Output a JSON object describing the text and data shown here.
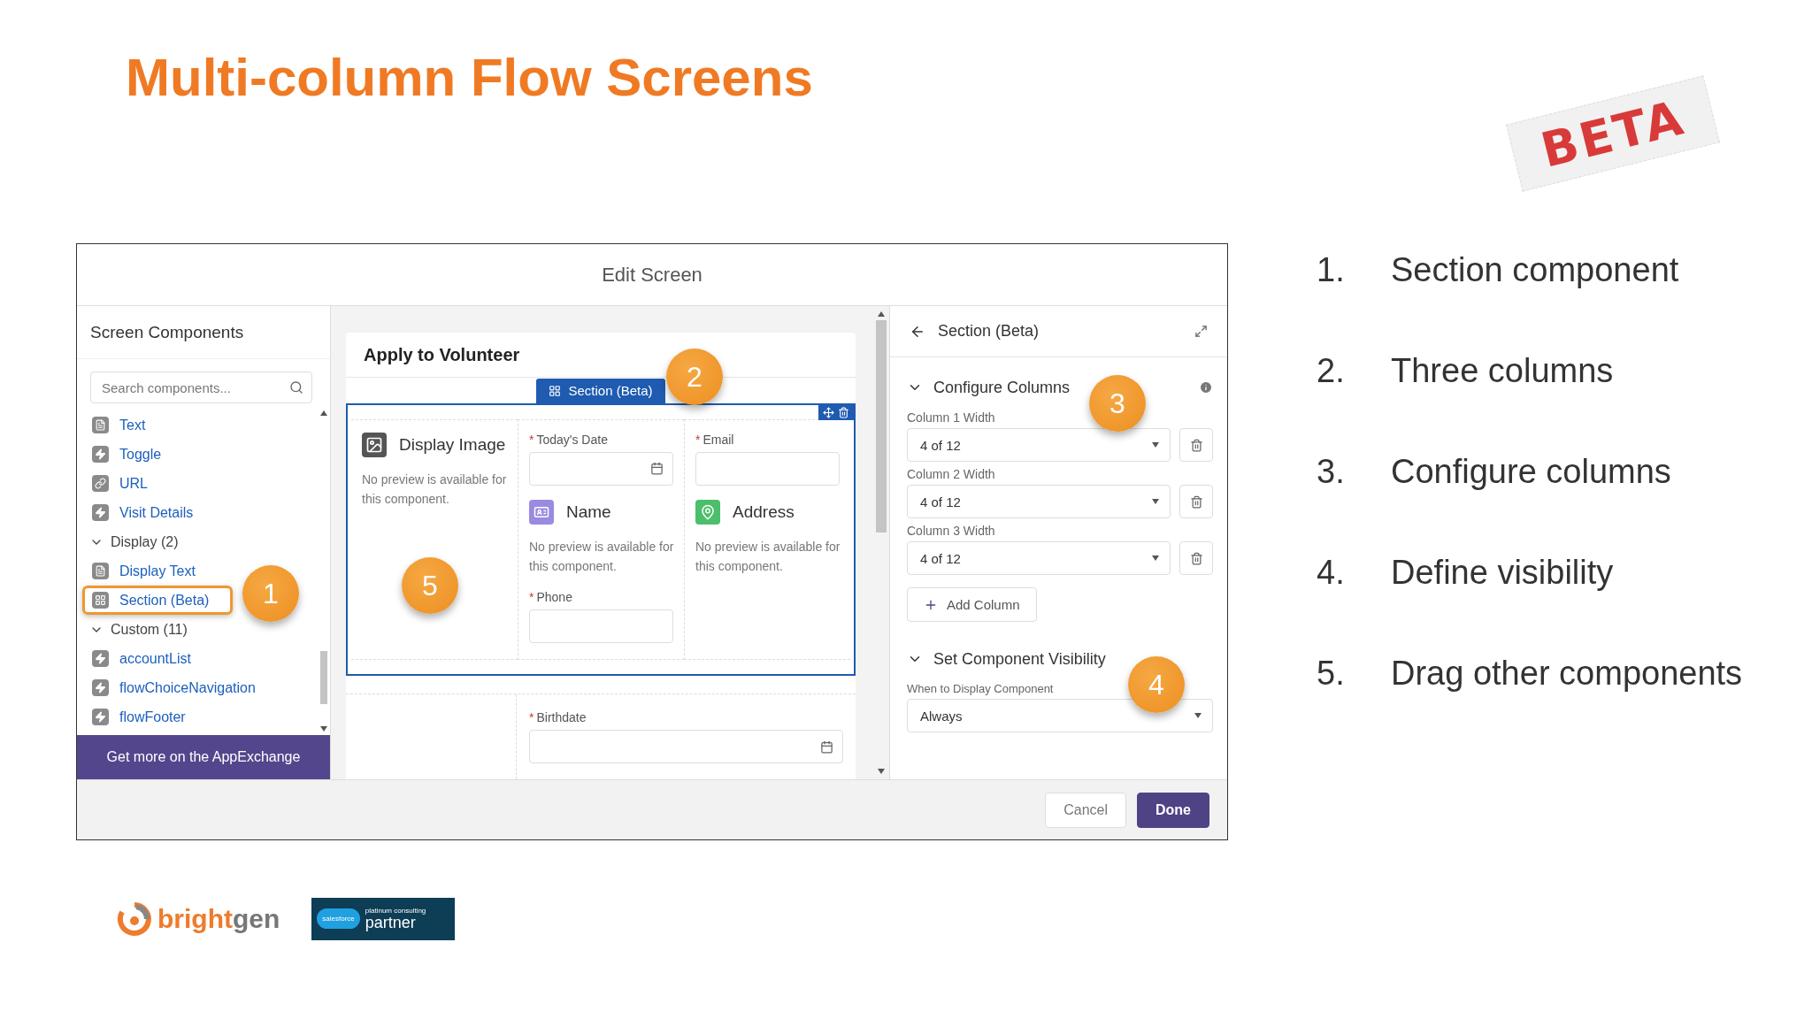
{
  "slide": {
    "title": "Multi-column Flow Screens",
    "sticker": "BETA"
  },
  "window": {
    "title": "Edit Screen"
  },
  "components_panel": {
    "title": "Screen Components",
    "search_placeholder": "Search components...",
    "items": [
      {
        "kind": "text",
        "label": "Text",
        "highlighted": false
      },
      {
        "kind": "bolt",
        "label": "Toggle",
        "highlighted": false
      },
      {
        "kind": "link",
        "label": "URL",
        "highlighted": false
      },
      {
        "kind": "bolt",
        "label": "Visit Details",
        "highlighted": false
      },
      {
        "kind": "group",
        "label": "Display (2)",
        "expanded": true,
        "children": [
          {
            "kind": "text",
            "label": "Display Text",
            "highlighted": false
          },
          {
            "kind": "section",
            "label": "Section (Beta)",
            "highlighted": true
          }
        ]
      },
      {
        "kind": "group",
        "label": "Custom (11)",
        "expanded": true,
        "children": [
          {
            "kind": "bolt",
            "label": "accountList",
            "highlighted": false
          },
          {
            "kind": "bolt",
            "label": "flowChoiceNavigation",
            "highlighted": false
          },
          {
            "kind": "bolt",
            "label": "flowFooter",
            "highlighted": false
          }
        ]
      }
    ],
    "footer_button": "Get more on the AppExchange"
  },
  "canvas": {
    "screen_title": "Apply to Volunteer",
    "section_tab": "Section (Beta)",
    "columns": [
      [
        {
          "kind": "image",
          "title": "Display Image",
          "note": "No preview is available for this component."
        }
      ],
      [
        {
          "kind": "date",
          "mark": "*",
          "label": "Today's Date"
        },
        {
          "kind": "name",
          "title": "Name",
          "note": "No preview is available for this component."
        },
        {
          "kind": "input",
          "mark": "*",
          "label": "Phone"
        }
      ],
      [
        {
          "kind": "input",
          "mark": "*",
          "label": "Email"
        },
        {
          "kind": "address",
          "title": "Address",
          "note": "No preview is available for this component."
        }
      ]
    ],
    "below": [
      {
        "kind": "date",
        "mark": "*",
        "label": "Birthdate"
      }
    ]
  },
  "properties": {
    "title": "Section (Beta)",
    "configure": {
      "title": "Configure Columns",
      "expanded": true,
      "columns": [
        {
          "label": "Column 1 Width",
          "value": "4 of 12"
        },
        {
          "label": "Column 2 Width",
          "value": "4 of 12"
        },
        {
          "label": "Column 3 Width",
          "value": "4 of 12"
        }
      ],
      "add_button": "Add Column"
    },
    "visibility": {
      "title": "Set Component Visibility",
      "expanded": true,
      "label": "When to Display Component",
      "value": "Always"
    }
  },
  "footer": {
    "buttons": [
      {
        "label": "Cancel",
        "kind": "neutral"
      },
      {
        "label": "Done",
        "kind": "brand"
      }
    ]
  },
  "callouts": [
    "1",
    "2",
    "3",
    "4",
    "5"
  ],
  "points": [
    {
      "number": "1.",
      "text": "Section component"
    },
    {
      "number": "2.",
      "text": "Three columns"
    },
    {
      "number": "3.",
      "text": "Configure columns"
    },
    {
      "number": "4.",
      "text": "Define visibility"
    },
    {
      "number": "5.",
      "text": "Drag other components"
    }
  ],
  "logos": {
    "brand": [
      "bright",
      "gen"
    ],
    "partner": {
      "cloud": "salesforce",
      "small": "platinum consulting",
      "big": "partner"
    }
  }
}
